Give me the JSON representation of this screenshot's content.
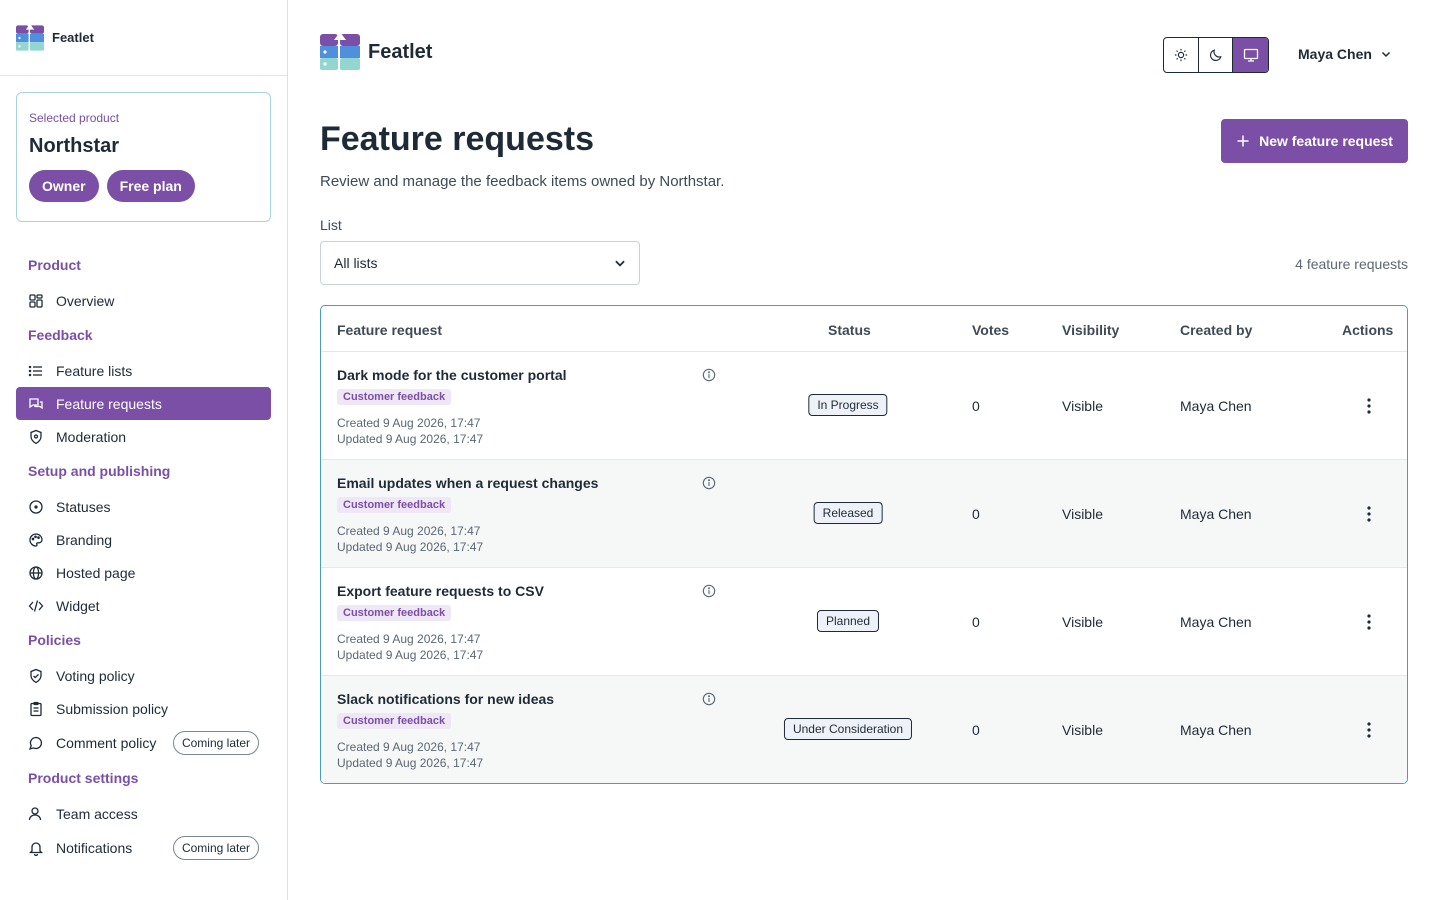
{
  "app": {
    "name": "Featlet"
  },
  "product_card": {
    "label": "Selected product",
    "name": "Northstar",
    "pills": [
      "Owner",
      "Free plan"
    ]
  },
  "nav": {
    "sections": [
      {
        "title": "Product",
        "items": [
          {
            "label": "Overview",
            "icon": "grid-icon"
          }
        ]
      },
      {
        "title": "Feedback",
        "items": [
          {
            "label": "Feature lists",
            "icon": "list-icon"
          },
          {
            "label": "Feature requests",
            "icon": "chat-icon",
            "active": true
          },
          {
            "label": "Moderation",
            "icon": "shield-icon"
          }
        ]
      },
      {
        "title": "Setup and publishing",
        "items": [
          {
            "label": "Statuses",
            "icon": "circle-dot-icon"
          },
          {
            "label": "Branding",
            "icon": "palette-icon"
          },
          {
            "label": "Hosted page",
            "icon": "globe-icon"
          },
          {
            "label": "Widget",
            "icon": "code-icon"
          }
        ]
      },
      {
        "title": "Policies",
        "items": [
          {
            "label": "Voting policy",
            "icon": "shield-check-icon"
          },
          {
            "label": "Submission policy",
            "icon": "clipboard-icon"
          },
          {
            "label": "Comment policy",
            "icon": "comment-icon",
            "badge": "Coming later"
          }
        ]
      },
      {
        "title": "Product settings",
        "items": [
          {
            "label": "Team access",
            "icon": "user-icon"
          },
          {
            "label": "Notifications",
            "icon": "bell-icon",
            "badge": "Coming later"
          }
        ]
      }
    ]
  },
  "header": {
    "user": "Maya Chen"
  },
  "page": {
    "title": "Feature requests",
    "subtitle": "Review and manage the feedback items owned by Northstar.",
    "new_button": "New feature request",
    "list_label": "List",
    "list_value": "All lists",
    "count": "4 feature requests"
  },
  "table": {
    "columns": [
      "Feature request",
      "Status",
      "Votes",
      "Visibility",
      "Created by",
      "Actions"
    ],
    "rows": [
      {
        "title": "Dark mode for the customer portal",
        "tag": "Customer feedback",
        "created": "Created 9 Aug 2026, 17:47",
        "updated": "Updated 9 Aug 2026, 17:47",
        "status": "In Progress",
        "votes": "0",
        "visibility": "Visible",
        "created_by": "Maya Chen"
      },
      {
        "title": "Email updates when a request changes",
        "tag": "Customer feedback",
        "created": "Created 9 Aug 2026, 17:47",
        "updated": "Updated 9 Aug 2026, 17:47",
        "status": "Released",
        "votes": "0",
        "visibility": "Visible",
        "created_by": "Maya Chen"
      },
      {
        "title": "Export feature requests to CSV",
        "tag": "Customer feedback",
        "created": "Created 9 Aug 2026, 17:47",
        "updated": "Updated 9 Aug 2026, 17:47",
        "status": "Planned",
        "votes": "0",
        "visibility": "Visible",
        "created_by": "Maya Chen"
      },
      {
        "title": "Slack notifications for new ideas",
        "tag": "Customer feedback",
        "created": "Created 9 Aug 2026, 17:47",
        "updated": "Updated 9 Aug 2026, 17:47",
        "status": "Under Consideration",
        "votes": "0",
        "visibility": "Visible",
        "created_by": "Maya Chen"
      }
    ]
  }
}
